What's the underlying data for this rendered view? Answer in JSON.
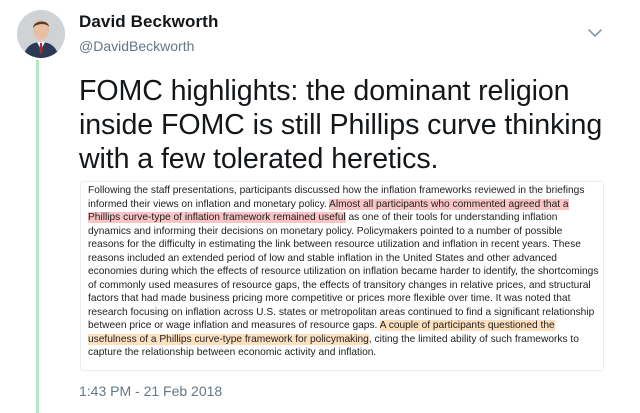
{
  "tweet": {
    "author_name": "David Beckworth",
    "author_handle": "@DavidBeckworth",
    "text": "FOMC highlights: the dominant religion inside FOMC is still Phillips curve thinking with a few tolerated heretics.",
    "timestamp": "1:43 PM - 21 Feb 2018"
  },
  "quote_image": {
    "segments": [
      {
        "text": "Following the staff presentations, participants discussed how the inflation frameworks reviewed in the briefings informed their views on inflation and monetary policy. ",
        "highlight": "none"
      },
      {
        "text": "Almost all participants who commented agreed that a Phillips curve-type of inflation framework remained useful",
        "highlight": "red"
      },
      {
        "text": " as one of their tools for understanding inflation dynamics and informing their decisions on monetary policy. Policymakers pointed to a number of possible reasons for the difficulty in estimating the link between resource utilization and inflation in recent years. These reasons included an extended period of low and stable inflation in the United States and other advanced economies during which the effects of resource utilization on inflation became harder to identify, the shortcomings of commonly used measures of resource gaps, the effects of transitory changes in relative prices, and structural factors that had made business pricing more competitive or prices more flexible over time. It was noted that research focusing on inflation across U.S. states or metropolitan areas continued to find a significant relationship between price or wage inflation and measures of resource gaps. ",
        "highlight": "none"
      },
      {
        "text": "A couple of participants questioned the usefulness of a Phillips curve-type framework for policymaking",
        "highlight": "orange"
      },
      {
        "text": ", citing the limited ability of such frameworks to capture the relationship between economic activity and inflation.",
        "highlight": "none"
      }
    ]
  },
  "icons": {
    "avatar": "profile-photo",
    "menu": "chevron-down-icon"
  },
  "colors": {
    "thread_line": "#b3e6c4",
    "highlight_red": "#f9c4c4",
    "highlight_orange": "#fde0c0",
    "secondary_text": "#657786"
  }
}
